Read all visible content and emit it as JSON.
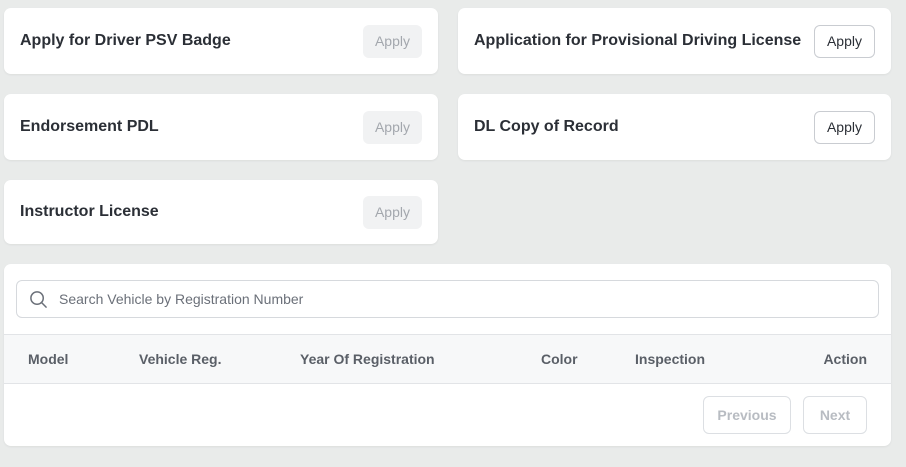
{
  "services": [
    {
      "title": "Apply for Driver PSV Badge",
      "button": "Apply",
      "enabled": false
    },
    {
      "title": "Application for Provisional Driving License",
      "button": "Apply",
      "enabled": true
    },
    {
      "title": "Endorsement PDL",
      "button": "Apply",
      "enabled": false
    },
    {
      "title": "DL Copy of Record",
      "button": "Apply",
      "enabled": true
    },
    {
      "title": "Instructor License",
      "button": "Apply",
      "enabled": false
    }
  ],
  "search": {
    "placeholder": "Search Vehicle by Registration Number",
    "value": "",
    "icon": "search-icon"
  },
  "table": {
    "columns": [
      "Model",
      "Vehicle Reg.",
      "Year Of Registration",
      "Color",
      "Inspection",
      "Action"
    ],
    "rows": []
  },
  "pagination": {
    "previous_label": "Previous",
    "next_label": "Next"
  },
  "colors": {
    "background": "#e9ebea",
    "card": "#ffffff",
    "disabled_button_bg": "#f1f2f3",
    "disabled_text": "#a3a7ad",
    "text": "#2b2f36"
  }
}
